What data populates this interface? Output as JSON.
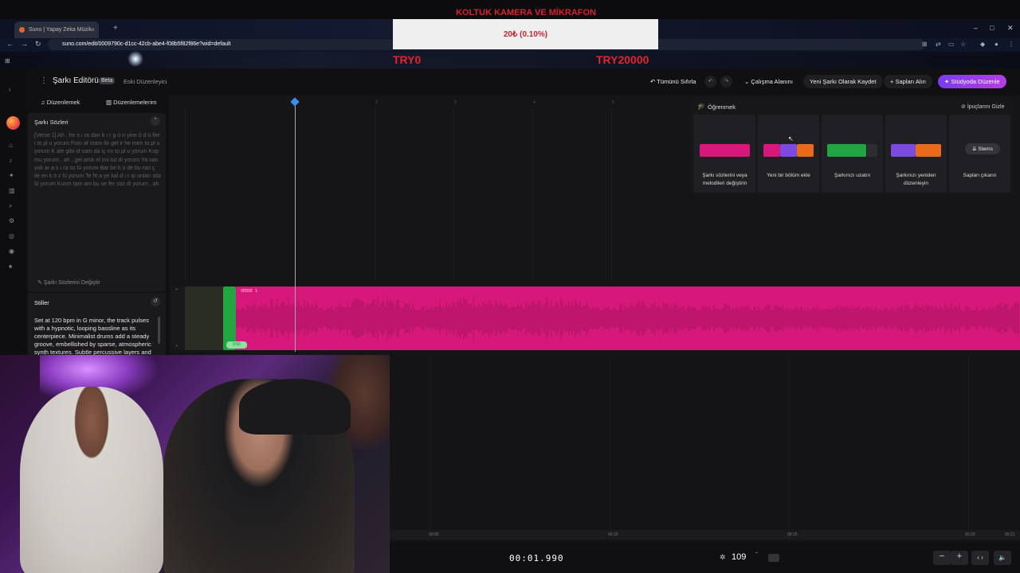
{
  "overlay": {
    "donation_title": "KOLTUK KAMERA VE MİKRAFON",
    "donation_progress": "20₺ (0.10%)",
    "donation_min": "TRY0",
    "donation_max": "TRY20000"
  },
  "browser": {
    "tab_title": "Suno | Yapay Zeka Müzik",
    "url": "suno.com/edit/0009790c-d1cc-42cb-abe4-f08b5f82f86e?wid=default"
  },
  "app": {
    "title": "Şarkı Editörü",
    "beta": "Beta",
    "legacy": "Eski Düzenleyici",
    "toolbar": {
      "reset_all": "Tümünü Sıfırla",
      "workspace": "Çalışma Alanını",
      "save_new": "Yeni Şarkı Olarak Kaydet",
      "get_stems": "Sapları Alın",
      "studio": "Stüdyoda Düzenle"
    }
  },
  "left": {
    "tab_edit": "Düzenlemek",
    "tab_my_edits": "Düzenlemelerim",
    "lyrics_header": "Şarkı Sözleri",
    "lyrics_text": "[Verse 1] Ah , he s ı ra dan b ı r g ü n yine ö d ü ller i to pl u yorum Foto af mam ile gel ir he men to pl u yorum K ale gibi ol sam da iç ını to pl u yorum Kop mu yorum , ah , gel artık el imi tut di yorum Ya van yok ar a s ı ra oz lü yorum Bar be k ü de bu rao ç ile en k ö z lü yorum Te ht a ye kal d ı r ıp onları söz lü yorum Kızım tam am bu se fer söz di yorum , ah",
    "lyrics_edit": "Şarkı Sözlerini Değiştir",
    "styles_header": "Stiller",
    "styles_text": "Set at 120 bpm in G minor, the track pulses with a hypnotic, looping bassline as its centerpiece. Minimalist drums add a steady groove, embellished by sparse, atmospheric synth textures. Subtle percussive layers and"
  },
  "timeline": {
    "ruler": [
      "1",
      "2",
      "3",
      "4",
      "5"
    ],
    "clip_label": "VERSE 1",
    "clip_badge": "0:00"
  },
  "learn": {
    "title": "Öğrenmek",
    "hide_tips": "İpuçlarını Gizle",
    "cards": [
      {
        "label": "Şarkı sözlerini veya melodileri değiştirin"
      },
      {
        "label": "Yeni bir bölüm ekle"
      },
      {
        "label": "Şarkınızı uzatın"
      },
      {
        "label": "Şarkınızı yeniden düzenleyin"
      },
      {
        "label": "Sapları çıkarın"
      }
    ],
    "stems_button": "Stems"
  },
  "bottom": {
    "scrub_labels": [
      "00:05",
      "00:10",
      "00:15",
      "00:20",
      "00:21"
    ],
    "time": "00:01.990",
    "bpm": "109",
    "zoom_out": "−",
    "zoom_in": "+",
    "fit": "‹ ›",
    "volume": "🔈"
  },
  "colors": {
    "clip_pink": "#d6187a",
    "clip_green": "#21a540",
    "accent_purple": "#8b3cf0",
    "donation_red": "#d5232e"
  }
}
